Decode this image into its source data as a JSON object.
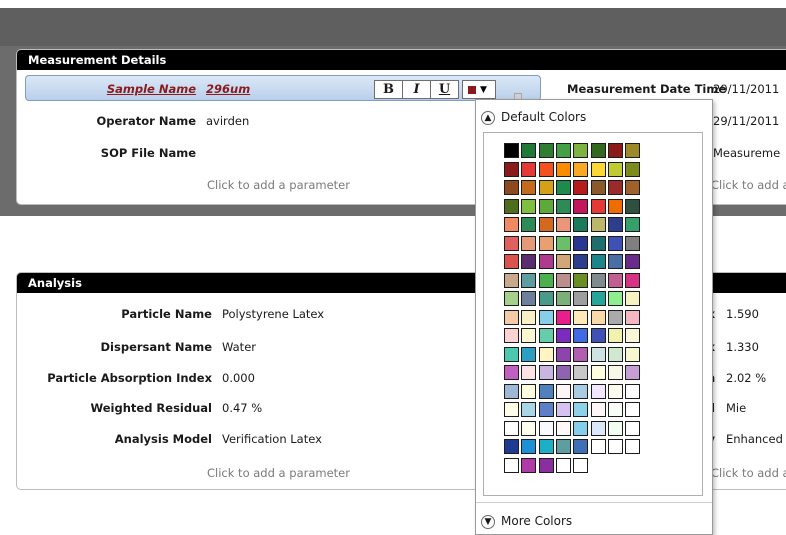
{
  "measurement": {
    "title": "Measurement Details",
    "sample_name_label": "Sample Name",
    "sample_name_value": "296um",
    "format_bold": "B",
    "format_italic": "I",
    "format_underline": "U",
    "operator_label": "Operator Name",
    "operator_value": "avirden",
    "sop_label": "SOP File Name",
    "sop_value": "",
    "add_param": "Click to add a parameter",
    "date_label": "Measurement Date Time",
    "date_value_1": "29/11/2011",
    "date_value_2": "29/11/2011",
    "right_row3_value": "Measureme",
    "right_add_param": "Click to add a",
    "partial_e1": "e",
    "partial_e2": "e"
  },
  "analysis": {
    "title": "Analysis",
    "rows": [
      {
        "label": "Particle Name",
        "value": "Polystyrene Latex"
      },
      {
        "label": "Dispersant Name",
        "value": "Water"
      },
      {
        "label": "Particle Absorption Index",
        "value": "0.000"
      },
      {
        "label": "Weighted Residual",
        "value": "0.47 %"
      },
      {
        "label": "Analysis Model",
        "value": "Verification Latex"
      }
    ],
    "add_param": "Click to add a parameter",
    "right_rows": [
      {
        "suffix": "x",
        "value": "1.590"
      },
      {
        "suffix": "x",
        "value": "1.330"
      },
      {
        "suffix": "n",
        "value": "2.02 %"
      },
      {
        "suffix": "l",
        "value": "Mie"
      },
      {
        "suffix": "y",
        "value": "Enhanced"
      }
    ],
    "right_add_param": "Click to add a"
  },
  "color_picker": {
    "default_label": "Default Colors",
    "more_label": "More Colors",
    "collapse_icon": "chevron-up-icon",
    "expand_icon": "chevron-down-icon",
    "selected_color": "#8b1a1a",
    "rows": [
      [
        "#000000",
        "#1f7a3a",
        "#2e7d32",
        "#43a047",
        "#7cb342",
        "#33691e",
        "#8b1a1a",
        "#9c8a2a"
      ],
      [
        "#8b1a1a",
        "#e53935",
        "#f4511e",
        "#fb8c00",
        "#f9a825",
        "#fdd835",
        "#c0ca33",
        "#7d8a1c"
      ],
      [
        "#8d4a1f",
        "#c46a1c",
        "#d4a017",
        "#1f8a4c",
        "#b71c1c",
        "#8a5a2b",
        "#9b2b2b",
        "#a0612b"
      ],
      [
        "#4e6e1e",
        "#7fbf3f",
        "#5fa83a",
        "#2e8b57",
        "#c2185b",
        "#e53935",
        "#ef6c00",
        "#2f4f3f"
      ],
      [
        "#ef8a62",
        "#2e8b57",
        "#d2691e",
        "#e9967a",
        "#1b7a5a",
        "#bdb76b",
        "#2c3e8c",
        "#35a06a"
      ],
      [
        "#e06060",
        "#e59a7a",
        "#e8a070",
        "#6abf6a",
        "#283593",
        "#1e6e6e",
        "#3f51b5",
        "#808080"
      ],
      [
        "#d9534f",
        "#5b2c6f",
        "#b03a8e",
        "#d2a679",
        "#2c3e8c",
        "#20858a",
        "#4a6fa5",
        "#6a2c8a"
      ],
      [
        "#c8a98c",
        "#5e9ea0",
        "#4caf50",
        "#bc8f8f",
        "#6b8e23",
        "#7f8c8d",
        "#c06090",
        "#d63384"
      ],
      [
        "#a8d08d",
        "#6d7f9a",
        "#4a9a8a",
        "#7bb07b",
        "#9e9e9e",
        "#26a69a",
        "#90ee90",
        "#f7f3c0"
      ],
      [
        "#f5cba7",
        "#faf0c8",
        "#87ceeb",
        "#e91e8c",
        "#fde9b8",
        "#f8d7a8",
        "#aaaaaa",
        "#f4b6c2"
      ],
      [
        "#fbd3d3",
        "#fef9d0",
        "#66cdaa",
        "#7b2cbf",
        "#4169e1",
        "#3f51b5",
        "#f1f1b0",
        "#fdf5d8"
      ],
      [
        "#48c9b0",
        "#2b9ec4",
        "#fef4c4",
        "#8e44ad",
        "#b05eb0",
        "#cfe3e3",
        "#cfe8cf",
        "#f8f8d0"
      ],
      [
        "#c060c0",
        "#fde3e3",
        "#c9b6e0",
        "#8e63b0",
        "#c8c8c8",
        "#ffffe0",
        "#f8f8e8",
        "#c79ed4"
      ],
      [
        "#9fb7d6",
        "#ffffe0",
        "#4f81bd",
        "#fef6f6",
        "#a9cce3",
        "#f5e6ff",
        "#fdfdf0",
        "#ffffff"
      ],
      [
        "#fffde7",
        "#a9d6e5",
        "#5d7fc9",
        "#d6c2f0",
        "#8fd1e8",
        "#fff7f7",
        "#f8fdf8",
        "#ffffff"
      ],
      [
        "#ffffff",
        "#fffff0",
        "#f9f9ff",
        "#fff8f8",
        "#87ceeb",
        "#dbe8f8",
        "#f0fff0",
        "#ffffff"
      ],
      [
        "#1f3a93",
        "#1e90d6",
        "#1bb0c8",
        "#5f9ea0",
        "#3f6fb5",
        "#ffffff",
        "#ffffff",
        "#ffffff"
      ],
      [
        "#ffffff",
        "#b03aa8",
        "#8b2fa0",
        "#ffffff",
        "#ffffff"
      ]
    ]
  }
}
